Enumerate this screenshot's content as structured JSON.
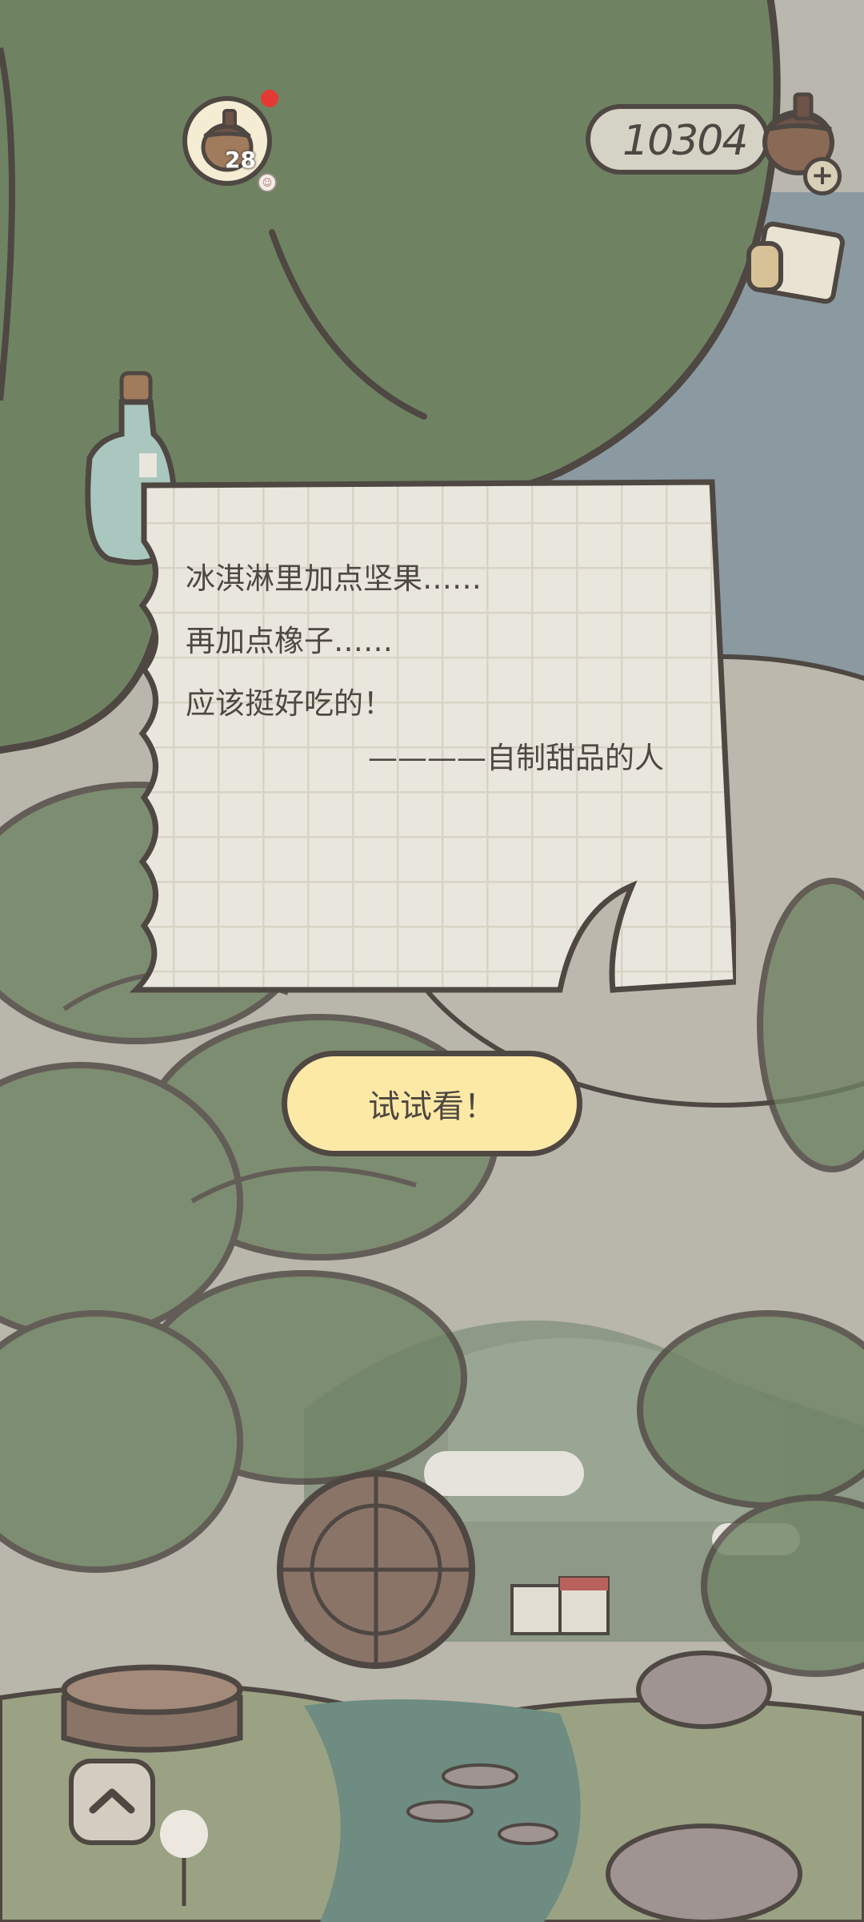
{
  "header": {
    "level": "28",
    "currency": "10304",
    "icons": {
      "level_badge": "acorn-level-icon",
      "currency": "acorn-icon",
      "add_currency": "plus-icon",
      "mail": "mail-icon",
      "notification": "red-dot-icon"
    }
  },
  "note": {
    "lines": [
      "冰淇淋里加点坚果……",
      "再加点橡子……",
      "应该挺好吃的！"
    ],
    "signature": "————自制甜品的人",
    "bottle_icon": "message-bottle-icon"
  },
  "actions": {
    "try_label": "试试看！",
    "expand_icon": "chevron-up-icon"
  },
  "colors": {
    "outline": "#4e4742",
    "leaf_green": "#6f8363",
    "button_yellow": "#fde9a6",
    "paper": "#e9e6dd",
    "badge_red": "#e53935"
  }
}
